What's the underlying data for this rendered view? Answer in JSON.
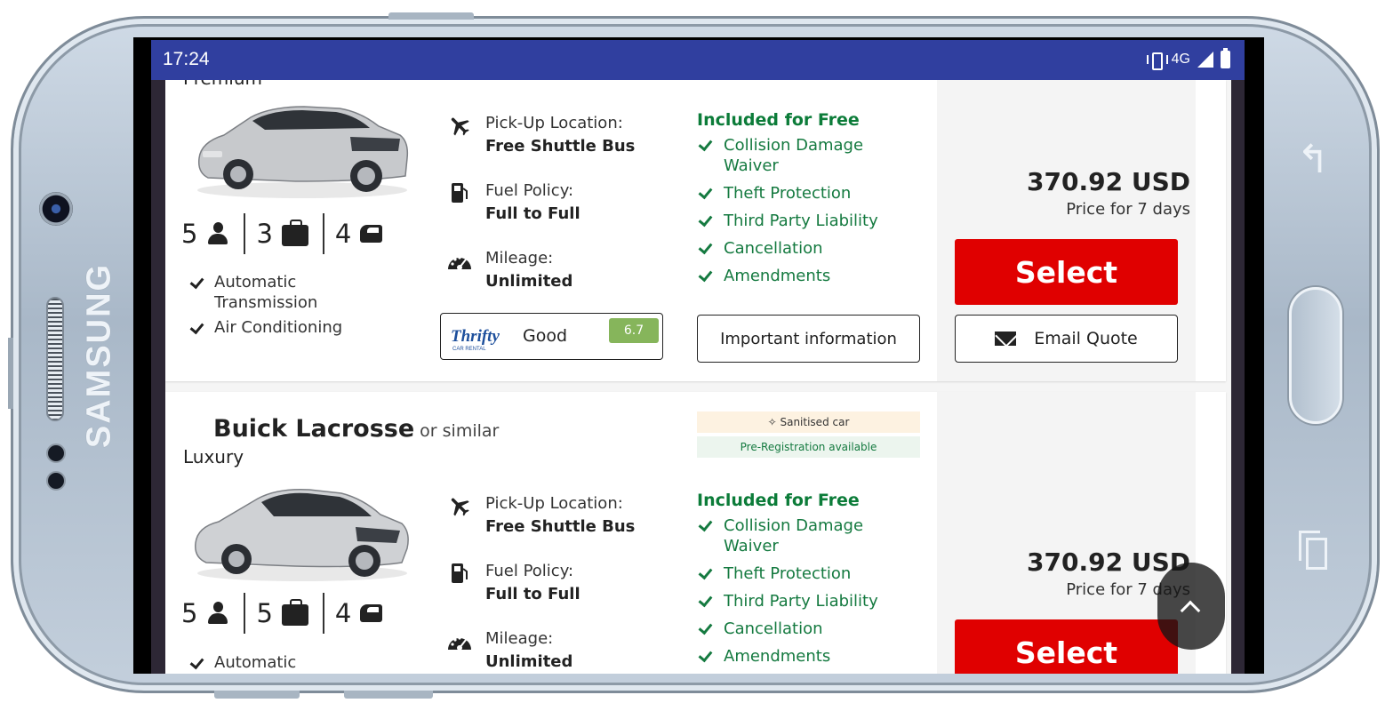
{
  "status_bar": {
    "time": "17:24",
    "network": "4G"
  },
  "device": {
    "brand": "SAMSUNG"
  },
  "cards": [
    {
      "category": "Premium",
      "specs": {
        "seats": "5",
        "bags": "3",
        "doors": "4"
      },
      "features": [
        "Automatic Transmission",
        "Air Conditioning"
      ],
      "pickup_label": "Pick-Up Location:",
      "pickup_value": "Free Shuttle Bus",
      "fuel_label": "Fuel Policy:",
      "fuel_value": "Full to Full",
      "mileage_label": "Mileage:",
      "mileage_value": "Unlimited",
      "supplier": "Thrifty",
      "supplier_sub": "CAR RENTAL",
      "rating_word": "Good",
      "rating_score": "6.7",
      "included_title": "Included for Free",
      "included": [
        "Collision Damage Waiver",
        "Theft Protection",
        "Third Party Liability",
        "Cancellation",
        "Amendments"
      ],
      "important_btn": "Important information",
      "price": "370.92 USD",
      "price_sub": "Price for 7 days",
      "select_btn": "Select",
      "email_btn": "Email Quote"
    },
    {
      "name": "Buick Lacrosse",
      "or_similar": "or similar",
      "category": "Luxury",
      "badges": {
        "sanitised": "Sanitised car",
        "preregistration": "Pre-Registration available"
      },
      "specs": {
        "seats": "5",
        "bags": "5",
        "doors": "4"
      },
      "features": [
        "Automatic"
      ],
      "pickup_label": "Pick-Up Location:",
      "pickup_value": "Free Shuttle Bus",
      "fuel_label": "Fuel Policy:",
      "fuel_value": "Full to Full",
      "mileage_label": "Mileage:",
      "mileage_value": "Unlimited",
      "included_title": "Included for Free",
      "included": [
        "Collision Damage Waiver",
        "Theft Protection",
        "Third Party Liability",
        "Cancellation",
        "Amendments"
      ],
      "price": "370.92 USD",
      "price_sub": "Price for 7 days",
      "select_btn": "Select"
    }
  ],
  "colors": {
    "status_bar": "#303f9f",
    "select": "#e00000",
    "included": "#0c7c39",
    "rating": "#86b55b"
  },
  "icons": [
    "vibrate-icon",
    "signal-icon",
    "battery-icon",
    "person-icon",
    "luggage-icon",
    "door-icon",
    "check-icon",
    "plane-icon",
    "fuel-icon",
    "speedometer-icon",
    "mail-icon",
    "sparkle-icon",
    "chevron-up-icon"
  ]
}
